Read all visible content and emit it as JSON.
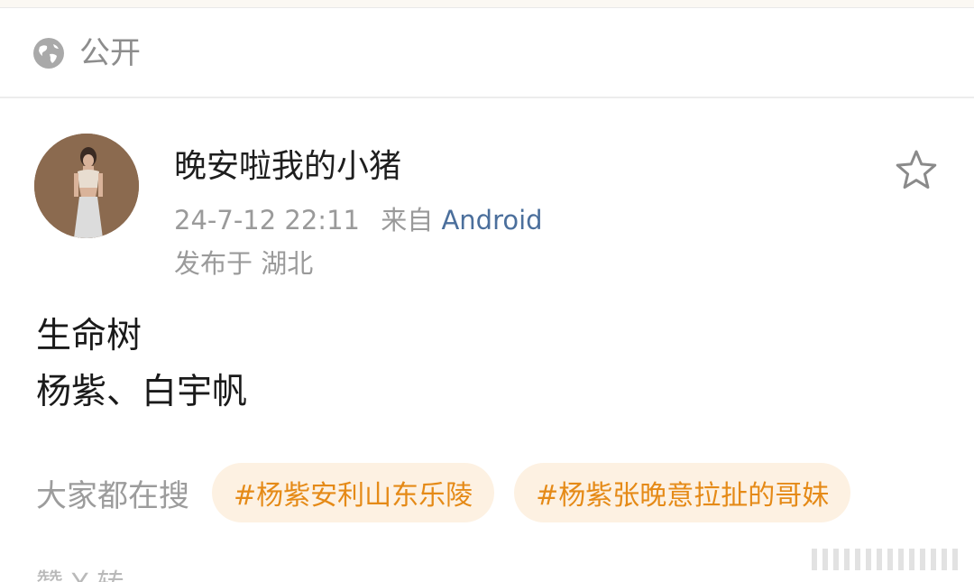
{
  "visibility": {
    "icon": "globe-icon",
    "label": "公开"
  },
  "post": {
    "username": "晚安啦我的小猪",
    "date": "24-7-12 22:11",
    "source_prefix": "来自",
    "source": "Android",
    "location": "发布于 湖北",
    "text_lines": [
      "生命树",
      "杨紫、白宇帆"
    ],
    "favorite_icon": "star-outline-icon"
  },
  "trending": {
    "label": "大家都在搜",
    "tags": [
      "#杨紫安利山东乐陵",
      "#杨紫张晚意拉扯的哥妹"
    ]
  },
  "next_line_partial": "赞 Y 转",
  "colors": {
    "accent_blue": "#4b6f9c",
    "tag_text": "#e58a17",
    "tag_bg": "#fdf1e2",
    "muted_text": "#9a9a9a"
  }
}
